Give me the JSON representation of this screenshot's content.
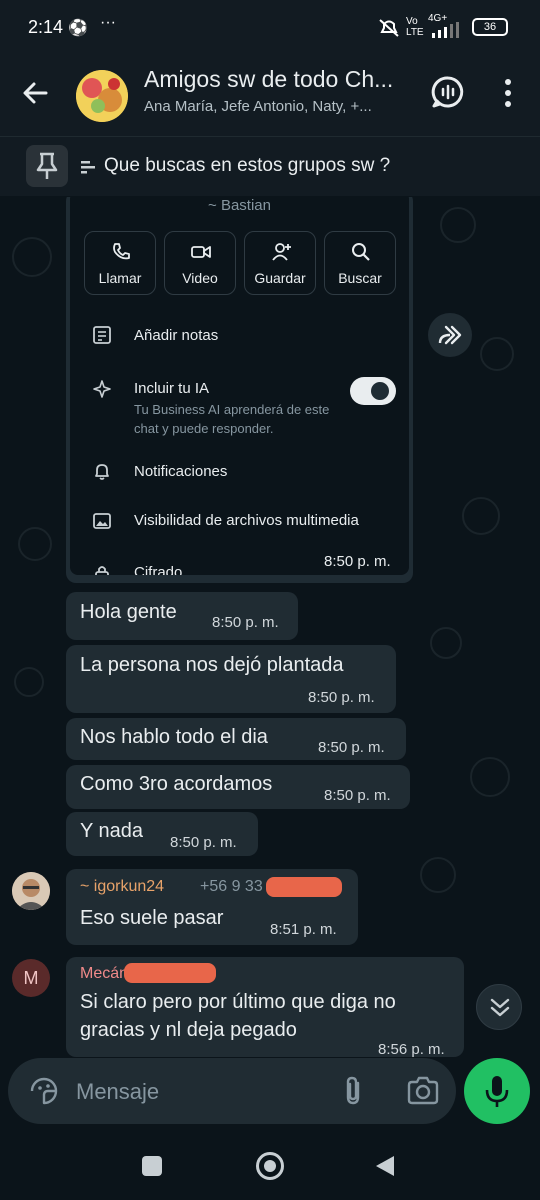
{
  "status_bar": {
    "time": "2:14",
    "network": "Vo LTE",
    "signal_label": "4G+",
    "battery": "36"
  },
  "header": {
    "title": "Amigos sw de todo  Ch...",
    "subtitle": "Ana María, Jefe Antonio, Naty, +..."
  },
  "pinned": {
    "text": "Que buscas en estos grupos sw ?"
  },
  "contact_card": {
    "name": "~ Bastian",
    "actions": [
      {
        "label": "Llamar",
        "icon": "phone-icon"
      },
      {
        "label": "Video",
        "icon": "video-icon"
      },
      {
        "label": "Guardar",
        "icon": "add-person-icon"
      },
      {
        "label": "Buscar",
        "icon": "search-icon"
      }
    ],
    "add_notes": "Añadir notas",
    "ai_title": "Incluir tu IA",
    "ai_sub": "Tu Business AI aprenderá de este chat y puede responder.",
    "ai_enabled": true,
    "notifications": "Notificaciones",
    "media_visibility": "Visibilidad de archivos multimedia",
    "encryption": "Cifrado",
    "time": "8:50 p. m."
  },
  "messages": [
    {
      "text": "Hola gente",
      "time": "8:50 p. m."
    },
    {
      "text": "La persona nos dejó plantada",
      "time": "8:50 p. m."
    },
    {
      "text": "Nos hablo todo el dia",
      "time": "8:50 p. m."
    },
    {
      "text": "Como 3ro acordamos",
      "time": "8:50 p. m."
    },
    {
      "text": "Y nada",
      "time": "8:50 p. m."
    },
    {
      "sender": "~ igorkun24",
      "phone": "+56 9 33",
      "text": "Eso suele pasar",
      "time": "8:51 p. m."
    },
    {
      "sender": "Mecán",
      "avatar_letter": "M",
      "text_line1": "Si claro pero por último que diga no",
      "text_line2": "gracias y nl deja pegado",
      "time": "8:56 p. m."
    }
  ],
  "composer": {
    "placeholder": "Mensaje"
  },
  "colors": {
    "accent_green": "#21c063",
    "bubble": "#202c33",
    "background": "#0b141a",
    "igorkun_name": "#e8a36a",
    "mecan_name": "#f08a8a"
  }
}
